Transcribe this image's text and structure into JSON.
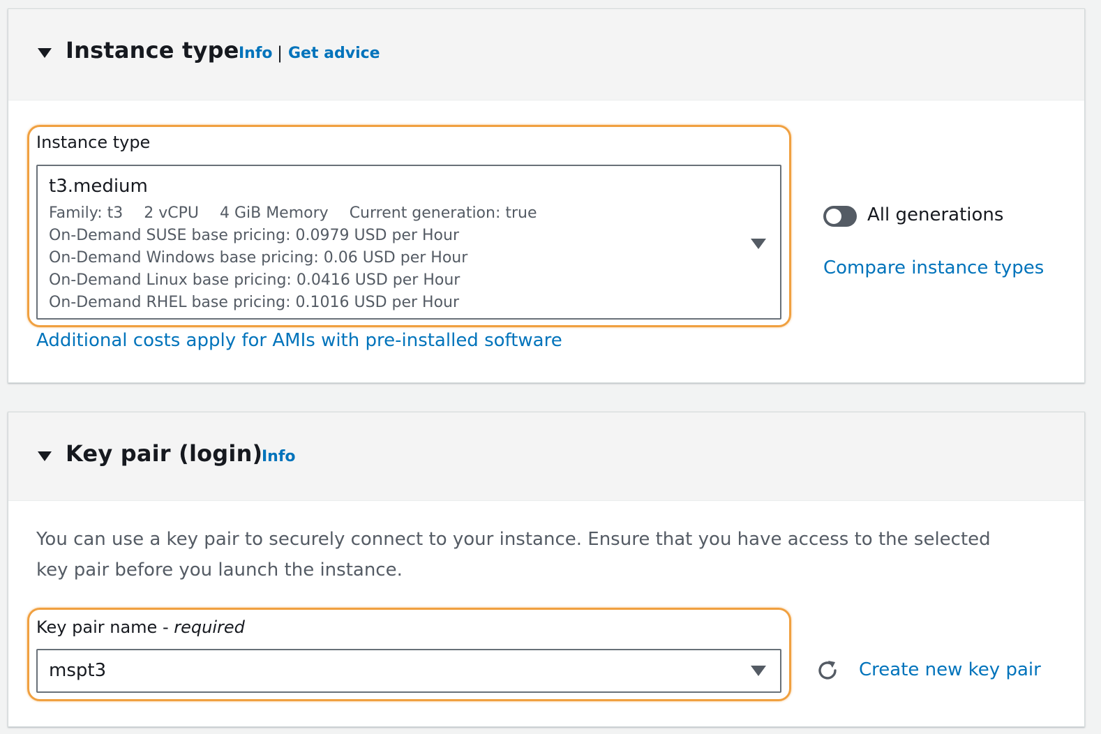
{
  "instance_type_section": {
    "title": "Instance type",
    "info_link": "Info",
    "separator": "|",
    "advice_link": "Get advice",
    "field_label": "Instance type",
    "selected": {
      "name": "t3.medium",
      "family": "Family: t3",
      "vcpu": "2 vCPU",
      "memory": "4 GiB Memory",
      "generation": "Current generation: true",
      "pricing": [
        "On-Demand SUSE base pricing: 0.0979 USD per Hour",
        "On-Demand Windows base pricing: 0.06 USD per Hour",
        "On-Demand Linux base pricing: 0.0416 USD per Hour",
        "On-Demand RHEL base pricing: 0.1016 USD per Hour"
      ]
    },
    "additional_costs_link": "Additional costs apply for AMIs with pre-installed software",
    "toggle_label": "All generations",
    "toggle_on": false,
    "compare_link": "Compare instance types"
  },
  "key_pair_section": {
    "title": "Key pair (login)",
    "info_link": "Info",
    "description": "You can use a key pair to securely connect to your instance. Ensure that you have access to the selected key pair before you launch the instance.",
    "field_label": "Key pair name",
    "field_label_dash": " - ",
    "field_required": "required",
    "selected_value": "mspt3",
    "create_link": "Create new key pair"
  },
  "colors": {
    "link": "#0073bb",
    "highlight": "#f0a040",
    "text": "#16191f",
    "secondary_text": "#545b64"
  }
}
